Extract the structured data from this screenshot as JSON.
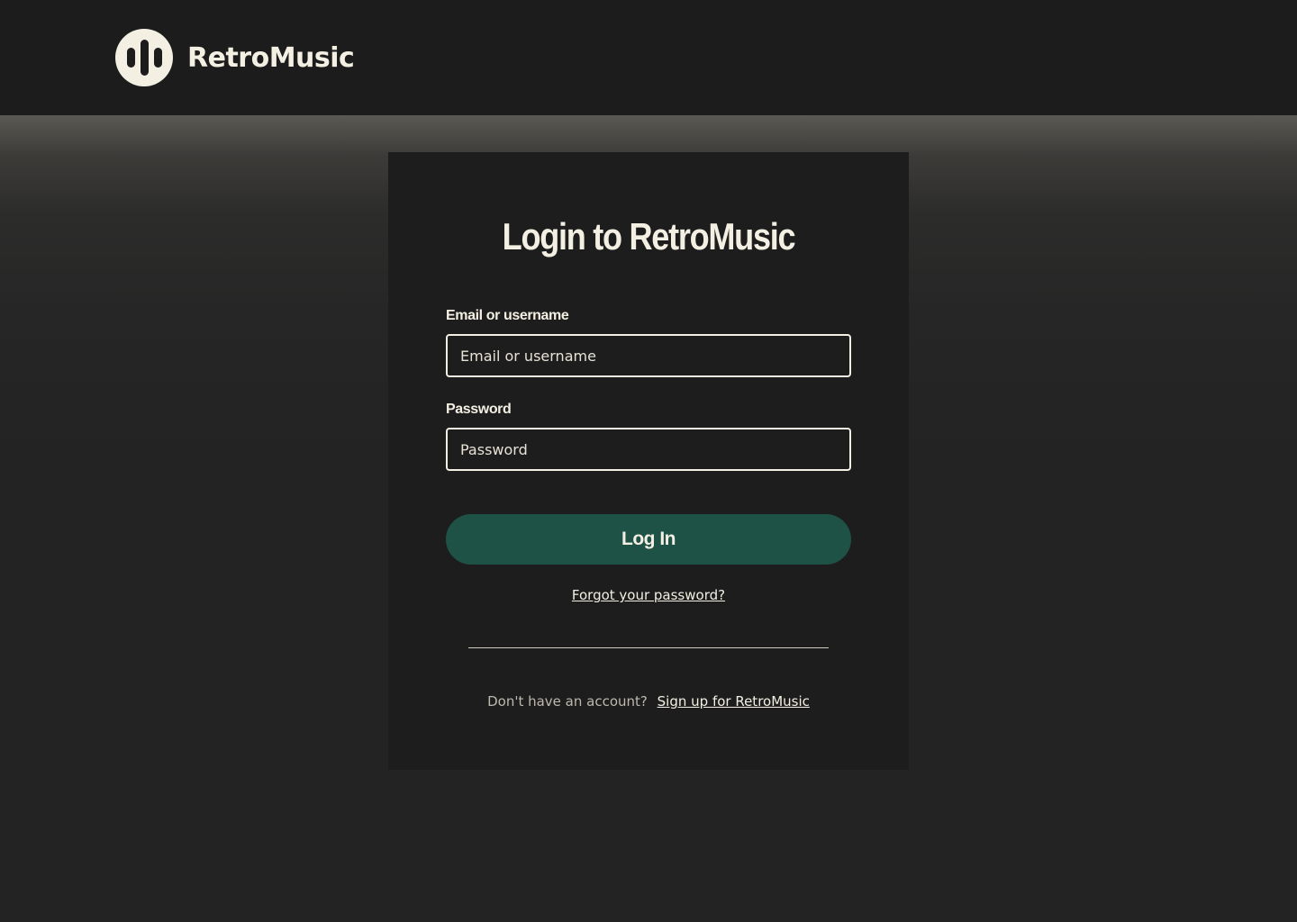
{
  "header": {
    "brand_name": "RetroMusic",
    "logo_icon": "sound-wave-icon"
  },
  "login": {
    "title": "Login to RetroMusic",
    "email_label": "Email or username",
    "email_placeholder": "Email or username",
    "email_value": "",
    "password_label": "Password",
    "password_placeholder": "Password",
    "password_value": "",
    "submit_label": "Log In",
    "forgot_link": "Forgot your password?",
    "signup_prompt": "Don't have an account?",
    "signup_link": "Sign up for RetroMusic"
  },
  "colors": {
    "background": "#232323",
    "header": "#1c1c1c",
    "card": "#1d1d1d",
    "text": "#f3efe3",
    "button": "#1e5247"
  }
}
